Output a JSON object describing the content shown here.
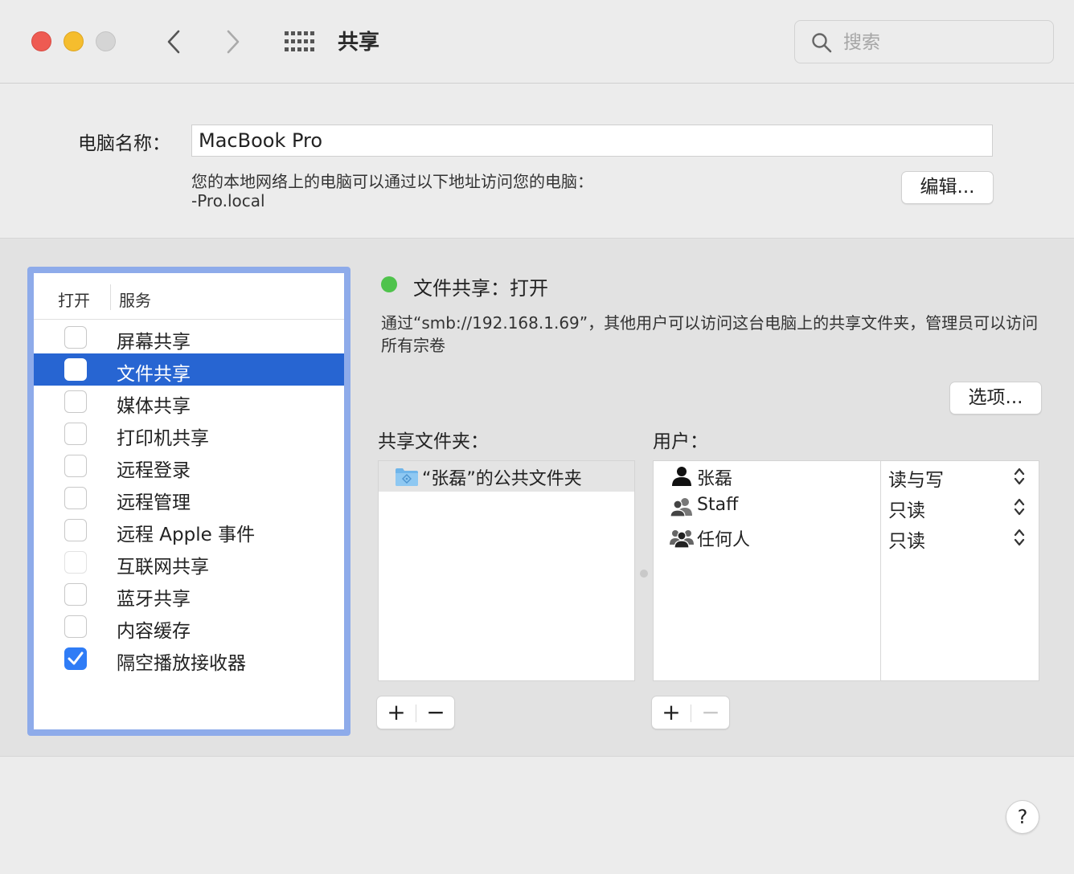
{
  "window": {
    "title": "共享",
    "search_placeholder": "搜索"
  },
  "computer_name": {
    "label": "电脑名称：",
    "value": "MacBook Pro",
    "address_description": "您的本地网络上的电脑可以通过以下地址访问您的电脑：",
    "address_value": "-Pro.local",
    "edit_button": "编辑..."
  },
  "services": {
    "header_on": "打开",
    "header_service": "服务",
    "items": [
      {
        "label": "屏幕共享",
        "checked": false,
        "selected": false
      },
      {
        "label": "文件共享",
        "checked": true,
        "selected": true
      },
      {
        "label": "媒体共享",
        "checked": false,
        "selected": false
      },
      {
        "label": "打印机共享",
        "checked": false,
        "selected": false
      },
      {
        "label": "远程登录",
        "checked": false,
        "selected": false
      },
      {
        "label": "远程管理",
        "checked": false,
        "selected": false
      },
      {
        "label": "远程 Apple 事件",
        "checked": false,
        "selected": false
      },
      {
        "label": "互联网共享",
        "checked": false,
        "selected": false,
        "dimmed": true
      },
      {
        "label": "蓝牙共享",
        "checked": false,
        "selected": false
      },
      {
        "label": "内容缓存",
        "checked": false,
        "selected": false
      },
      {
        "label": "隔空播放接收器",
        "checked": true,
        "selected": false
      }
    ]
  },
  "detail": {
    "status_title": "文件共享：打开",
    "status_color": "#4fc34c",
    "description": "通过“smb://192.168.1.69”，其他用户可以访问这台电脑上的共享文件夹，管理员可以访问所有宗卷",
    "options_button": "选项...",
    "folders_label": "共享文件夹：",
    "users_label": "用户：",
    "folders": [
      {
        "name": "“张磊”的公共文件夹",
        "icon": "public-folder-icon"
      }
    ],
    "users": [
      {
        "name": "张磊",
        "permission": "读与写",
        "icon": "single-user-icon"
      },
      {
        "name": "Staff",
        "permission": "只读",
        "icon": "group-icon"
      },
      {
        "name": "任何人",
        "permission": "只读",
        "icon": "everyone-icon"
      }
    ]
  },
  "controls": {
    "plus": "+",
    "minus": "−",
    "help": "?"
  },
  "colors": {
    "selection": "#2765d2",
    "checkbox_checked": "#2f7cf6",
    "focus_ring": "#8eabea"
  }
}
